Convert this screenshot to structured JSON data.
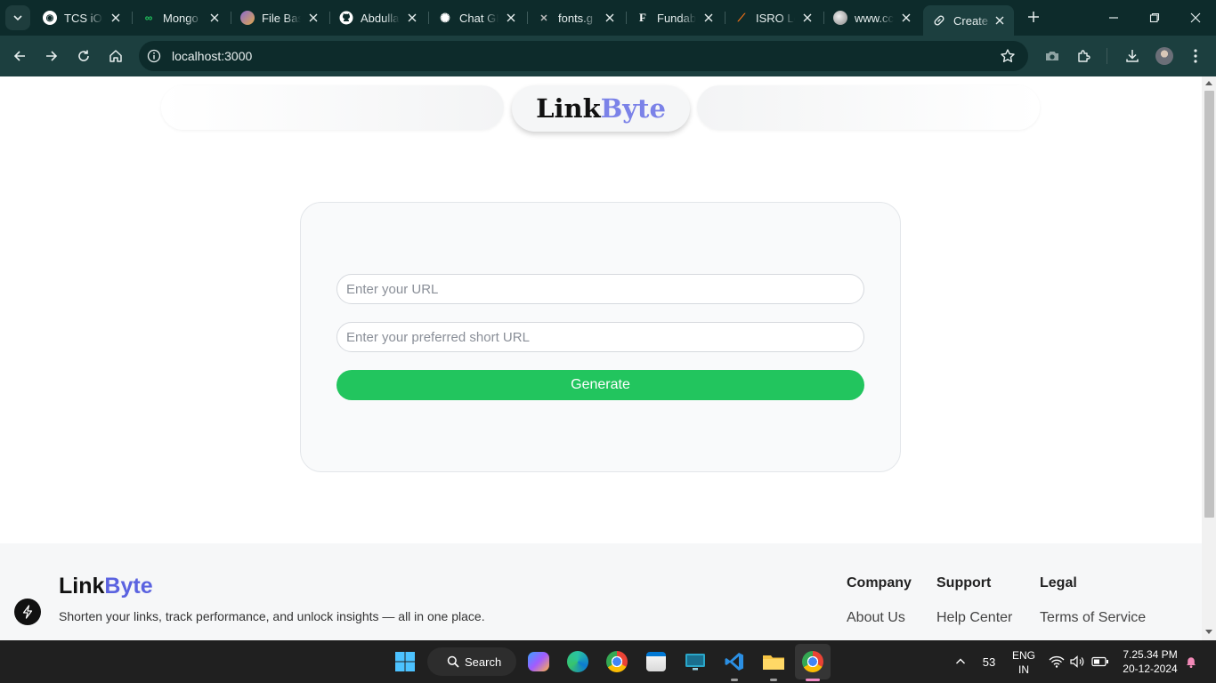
{
  "browser": {
    "tabs": [
      {
        "title": "TCS iON",
        "favicon": "tcs-icon",
        "color": "#ffffff"
      },
      {
        "title": "Mongo",
        "favicon": "mongodb-icon",
        "color": "#22c55e"
      },
      {
        "title": "File Bas",
        "favicon": "file-base-icon",
        "color": "#8a6bd1"
      },
      {
        "title": "Abdulla",
        "favicon": "github-icon",
        "color": "#ffffff"
      },
      {
        "title": "Chat GI",
        "favicon": "chatgpt-icon",
        "color": "#ffffff"
      },
      {
        "title": "fonts.g",
        "favicon": "fonts-icon",
        "color": "#bbbbbb"
      },
      {
        "title": "Fundab",
        "favicon": "fundable-icon",
        "color": "#e11d48"
      },
      {
        "title": "ISRO Le",
        "favicon": "isro-icon",
        "color": "#f97316"
      },
      {
        "title": "www.cc",
        "favicon": "globe-icon",
        "color": "#cccccc"
      },
      {
        "title": "Create",
        "favicon": "link-icon",
        "color": "#e6eeee"
      }
    ],
    "address": "localhost:3000"
  },
  "page": {
    "logo_part1": "Link",
    "logo_part2": "Byte",
    "form": {
      "url_placeholder": "Enter your URL",
      "short_placeholder": "Enter your preferred short URL",
      "button_label": "Generate"
    },
    "footer": {
      "logo_part1": "Link",
      "logo_part2": "Byte",
      "tagline": "Shorten your links, track performance, and unlock insights — all in one place.",
      "columns": [
        {
          "heading": "Company",
          "link": "About Us"
        },
        {
          "heading": "Support",
          "link": "Help Center"
        },
        {
          "heading": "Legal",
          "link": "Terms of Service"
        }
      ]
    },
    "colors": {
      "accent_green": "#22c55e",
      "brand_blue": "#7b82e8"
    }
  },
  "taskbar": {
    "search_label": "Search",
    "tray": {
      "notification_count": "53",
      "lang_line1": "ENG",
      "lang_line2": "IN",
      "time": "7.25.34 PM",
      "date": "20-12-2024"
    }
  }
}
